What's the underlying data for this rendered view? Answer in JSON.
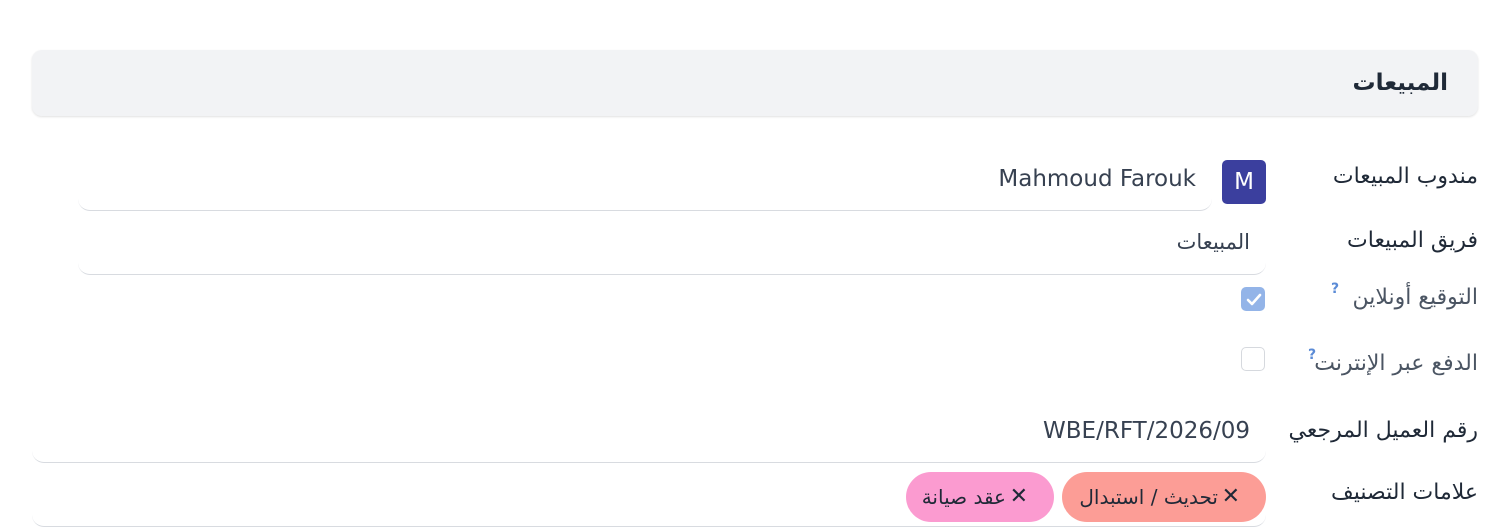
{
  "section": {
    "title": "المبيعات"
  },
  "fields": {
    "salesperson": {
      "label": "مندوب المبيعات",
      "avatar_letter": "M",
      "value": "Mahmoud Farouk"
    },
    "sales_team": {
      "label": "فريق المبيعات",
      "value": "المبيعات"
    },
    "online_signature": {
      "label": "التوقيع أونلاين",
      "help": "?",
      "checked": true
    },
    "online_payment": {
      "label": "الدفع عبر الإنترنت",
      "help": "?",
      "checked": false
    },
    "customer_reference": {
      "label": "رقم العميل المرجعي",
      "value": "WBE/RFT/2026/09"
    },
    "tags": {
      "label": "علامات التصنيف",
      "remove_symbol": "✕",
      "items": [
        {
          "label": "تحديث / استبدال",
          "color": "#fc9d96"
        },
        {
          "label": "عقد صيانة",
          "color": "#fb9bd0"
        }
      ]
    }
  },
  "colors": {
    "avatar_bg": "#3b3f9e",
    "checkbox_checked": "#93b4e8",
    "help_icon": "#5b8bd6",
    "header_bg": "#f2f3f5"
  }
}
